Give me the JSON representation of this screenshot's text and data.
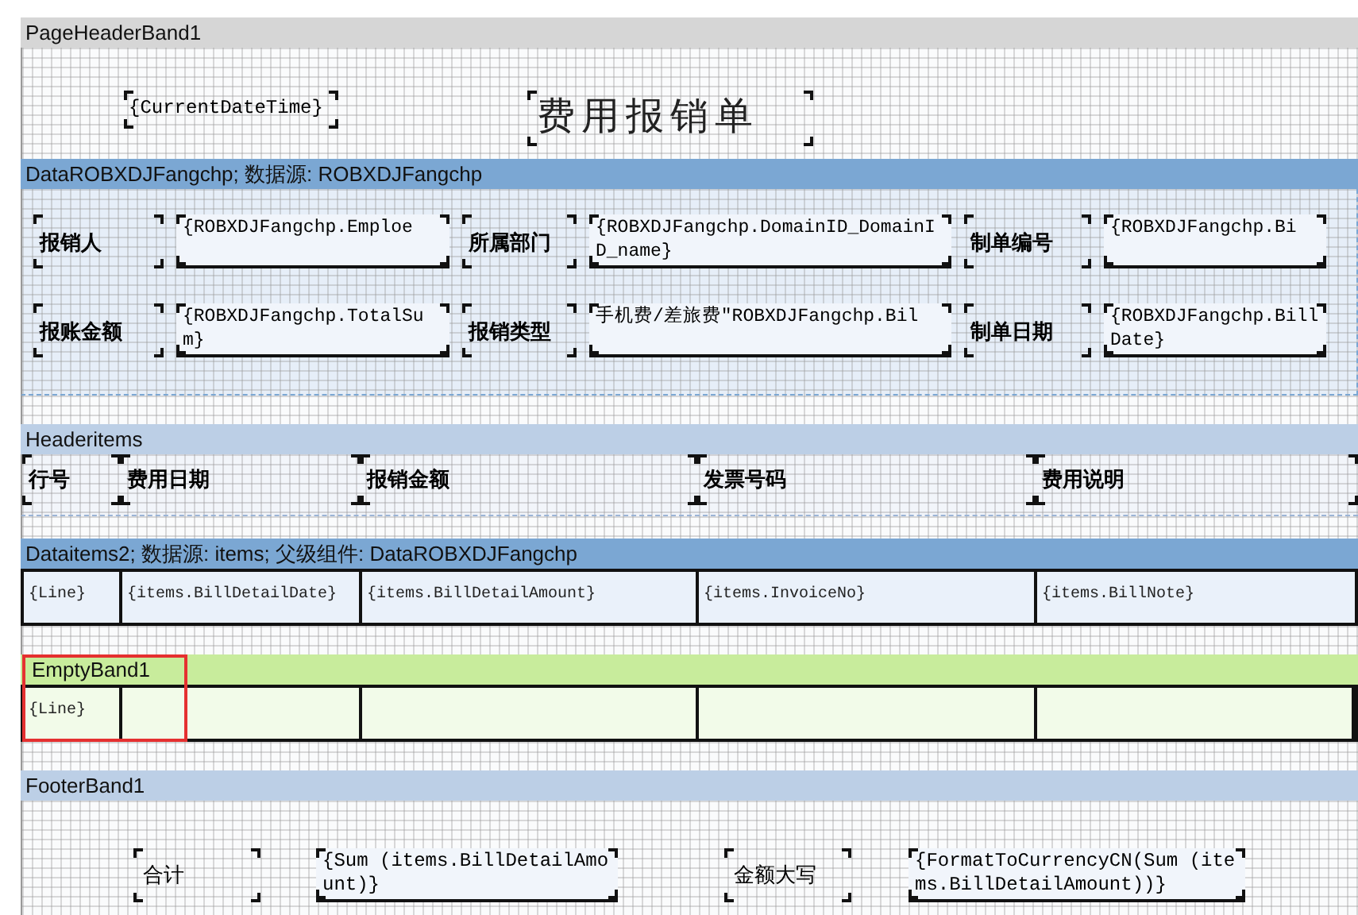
{
  "page_header": {
    "title": "PageHeaderBand1",
    "date_field": "{CurrentDateTime}",
    "report_title": "费用报销单"
  },
  "data_band": {
    "title": "DataROBXDJFangchp; 数据源: ROBXDJFangchp",
    "rows": [
      [
        {
          "label": "报销人",
          "value": "{ROBXDJFangchp.Emploe"
        },
        {
          "label": "所属部门",
          "value": "{ROBXDJFangchp.DomainID_DomainID_name}"
        },
        {
          "label": "制单编号",
          "value": "{ROBXDJFangchp.Bi"
        }
      ],
      [
        {
          "label": "报账金额",
          "value": "{ROBXDJFangchp.TotalSum}"
        },
        {
          "label": "报销类型",
          "value": "手机费/差旅费\"ROBXDJFangchp.Bil"
        },
        {
          "label": "制单日期",
          "value": "{ROBXDJFangchp.BillDate}"
        }
      ]
    ]
  },
  "header_items": {
    "title": "Headeritems",
    "columns": [
      "行号",
      "费用日期",
      "报销金额",
      "发票号码",
      "费用说明"
    ]
  },
  "data_items": {
    "title": "Dataitems2; 数据源: items; 父级组件: DataROBXDJFangchp",
    "cells": [
      "{Line}",
      "{items.BillDetailDate}",
      "{items.BillDetailAmount}",
      "{items.InvoiceNo}",
      "{items.BillNote}"
    ]
  },
  "empty_band": {
    "title": "EmptyBand1",
    "line_field": "{Line}"
  },
  "footer": {
    "title": "FooterBand1",
    "fields": [
      {
        "label": "合计",
        "value": "{Sum (items.BillDetailAmount)}"
      },
      {
        "label": "金额大写",
        "value": "{FormatToCurrencyCN(Sum (items.BillDetailAmount))}"
      }
    ]
  }
}
